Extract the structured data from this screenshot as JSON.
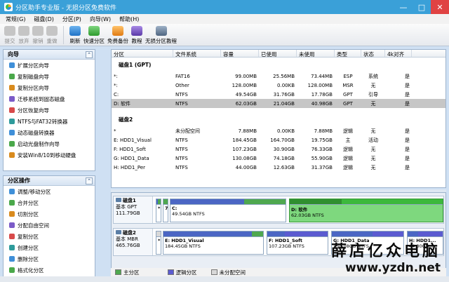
{
  "window": {
    "title": "分区助手专业版 - 无损分区免费软件",
    "controls": [
      "—",
      "□",
      "✕"
    ]
  },
  "menu": [
    "常规(G)",
    "磁盘(D)",
    "分区(P)",
    "向导(W)",
    "帮助(H)"
  ],
  "toolbar": {
    "items": [
      {
        "label": "提交",
        "icon": "submit-icon",
        "enabled": false
      },
      {
        "label": "放弃",
        "icon": "discard-icon",
        "enabled": false
      },
      {
        "label": "撤销",
        "icon": "undo-icon",
        "enabled": false
      },
      {
        "label": "重做",
        "icon": "redo-icon",
        "enabled": false
      },
      {
        "label": "刷新",
        "icon": "refresh-icon",
        "enabled": true
      },
      {
        "label": "快速分区",
        "icon": "quick-partition-icon",
        "enabled": true
      },
      {
        "label": "免费备份",
        "icon": "backup-icon",
        "enabled": true
      },
      {
        "label": "教程",
        "icon": "tutorial-icon",
        "enabled": true
      },
      {
        "label": "无损分区教程",
        "icon": "lossless-tutorial-icon",
        "enabled": true
      }
    ]
  },
  "wizard_panel": {
    "title": "向导",
    "items": [
      "扩展分区向导",
      "复制磁盘向导",
      "复制分区向导",
      "迁移系统到固态磁盘",
      "分区恢复向导",
      "NTFS与FAT32转换器",
      "动态磁盘转换器",
      "启动光盘制作向导",
      "安装Win8/10到移动硬盘"
    ]
  },
  "partition_ops_panel": {
    "title": "分区操作",
    "items": [
      "调整/移动分区",
      "合并分区",
      "切割分区",
      "分配自由空间",
      "复制分区",
      "创建分区",
      "删除分区",
      "格式化分区"
    ]
  },
  "table": {
    "columns": [
      "分区",
      "文件系统",
      "容量",
      "已使用",
      "未使用",
      "类型",
      "状态",
      "4k对齐"
    ],
    "disks": [
      {
        "header": "磁盘1 (GPT)",
        "rows": [
          [
            "*:",
            "FAT16",
            "99.00MB",
            "25.56MB",
            "73.44MB",
            "ESP",
            "系统",
            "是"
          ],
          [
            "*:",
            "Other",
            "128.00MB",
            "0.00KB",
            "128.00MB",
            "MSR",
            "无",
            "是"
          ],
          [
            "C:",
            "NTFS",
            "49.54GB",
            "31.76GB",
            "17.78GB",
            "GPT",
            "引导",
            "是"
          ],
          [
            "D: 软件",
            "NTFS",
            "62.03GB",
            "21.04GB",
            "40.98GB",
            "GPT",
            "无",
            "是"
          ]
        ]
      },
      {
        "header": "磁盘2",
        "rows": [
          [
            "*",
            "未分配空间",
            "7.88MB",
            "0.00KB",
            "7.88MB",
            "逻辑",
            "无",
            "是"
          ],
          [
            "E: HDD1_Visual",
            "NTFS",
            "184.45GB",
            "164.70GB",
            "19.75GB",
            "主",
            "活动",
            "是"
          ],
          [
            "F: HDD1_Soft",
            "NTFS",
            "107.23GB",
            "30.90GB",
            "76.33GB",
            "逻辑",
            "无",
            "是"
          ],
          [
            "G: HDD1_Data",
            "NTFS",
            "130.08GB",
            "74.18GB",
            "55.90GB",
            "逻辑",
            "无",
            "是"
          ],
          [
            "H: HDD1_Per",
            "NTFS",
            "44.00GB",
            "12.63GB",
            "31.37GB",
            "逻辑",
            "无",
            "是"
          ]
        ]
      }
    ],
    "selected_row": "D: 软件"
  },
  "disk_map": [
    {
      "name": "磁盘1",
      "type": "基本 GPT",
      "size": "111.79GB",
      "partitions": [
        {
          "name": "*",
          "size": "",
          "used": 0.26
        },
        {
          "name": "7",
          "size": "",
          "used": 0.0
        },
        {
          "name": "C:",
          "size": "49.54GB NTFS",
          "used": 0.64
        },
        {
          "name": "D: 软件",
          "size": "62.03GB NTFS",
          "used": 0.34,
          "selected": true
        }
      ]
    },
    {
      "name": "磁盘2",
      "type": "基本 MBR",
      "size": "465.76GB",
      "partitions": [
        {
          "name": "*",
          "size": "",
          "used": 0.0
        },
        {
          "name": "E: HDD1_Visual",
          "size": "184.45GB NTFS",
          "used": 0.89
        },
        {
          "name": "F: HDD1_Soft",
          "size": "107.23GB NTFS",
          "used": 0.29
        },
        {
          "name": "G: HDD1_Data",
          "size": "130.08GB NTFS",
          "used": 0.57
        },
        {
          "name": "H: HDD1...",
          "size": "44.00GB...",
          "used": 0.29
        }
      ]
    }
  ],
  "legend": [
    "主分区",
    "逻辑分区",
    "未分配空间"
  ],
  "colors": {
    "titlebar": "#3aa0d8",
    "primary": "#4fa84f",
    "logical": "#5b5bd0",
    "unallocated": "#d8d8d8",
    "used_bar": "#4b66c4",
    "selected": "#7ed87e"
  },
  "watermark": {
    "line1": "薛店亿众电脑",
    "line2": "www.yzdn.net"
  }
}
